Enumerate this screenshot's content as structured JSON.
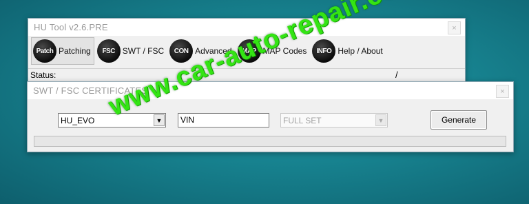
{
  "main_window": {
    "title": "HU Tool v2.6.PRE",
    "close_glyph": "×",
    "toolbar": [
      {
        "badge": "Patch",
        "label": "Patching",
        "icon": "patch-icon",
        "active": true
      },
      {
        "badge": "FSC",
        "label": "SWT / FSC",
        "icon": "fsc-icon"
      },
      {
        "badge": "CON",
        "label": "Advanced",
        "icon": "con-icon"
      },
      {
        "badge": "MAP",
        "label": "MAP Codes",
        "icon": "map-icon"
      },
      {
        "badge": "INFO",
        "label": "Help / About",
        "icon": "info-icon"
      }
    ],
    "status_label": "Status:",
    "status_separator": "/"
  },
  "dialog": {
    "title": "SWT / FSC CERTIFICATES",
    "close_glyph": "×",
    "device_select": {
      "value": "HU_EVO"
    },
    "vin_field": {
      "value": "VIN"
    },
    "set_select": {
      "value": "FULL SET",
      "disabled": true
    },
    "generate_label": "Generate",
    "progress": 0
  },
  "watermark": {
    "text": "www.car-auto-repair.com",
    "color": "#34e414"
  }
}
